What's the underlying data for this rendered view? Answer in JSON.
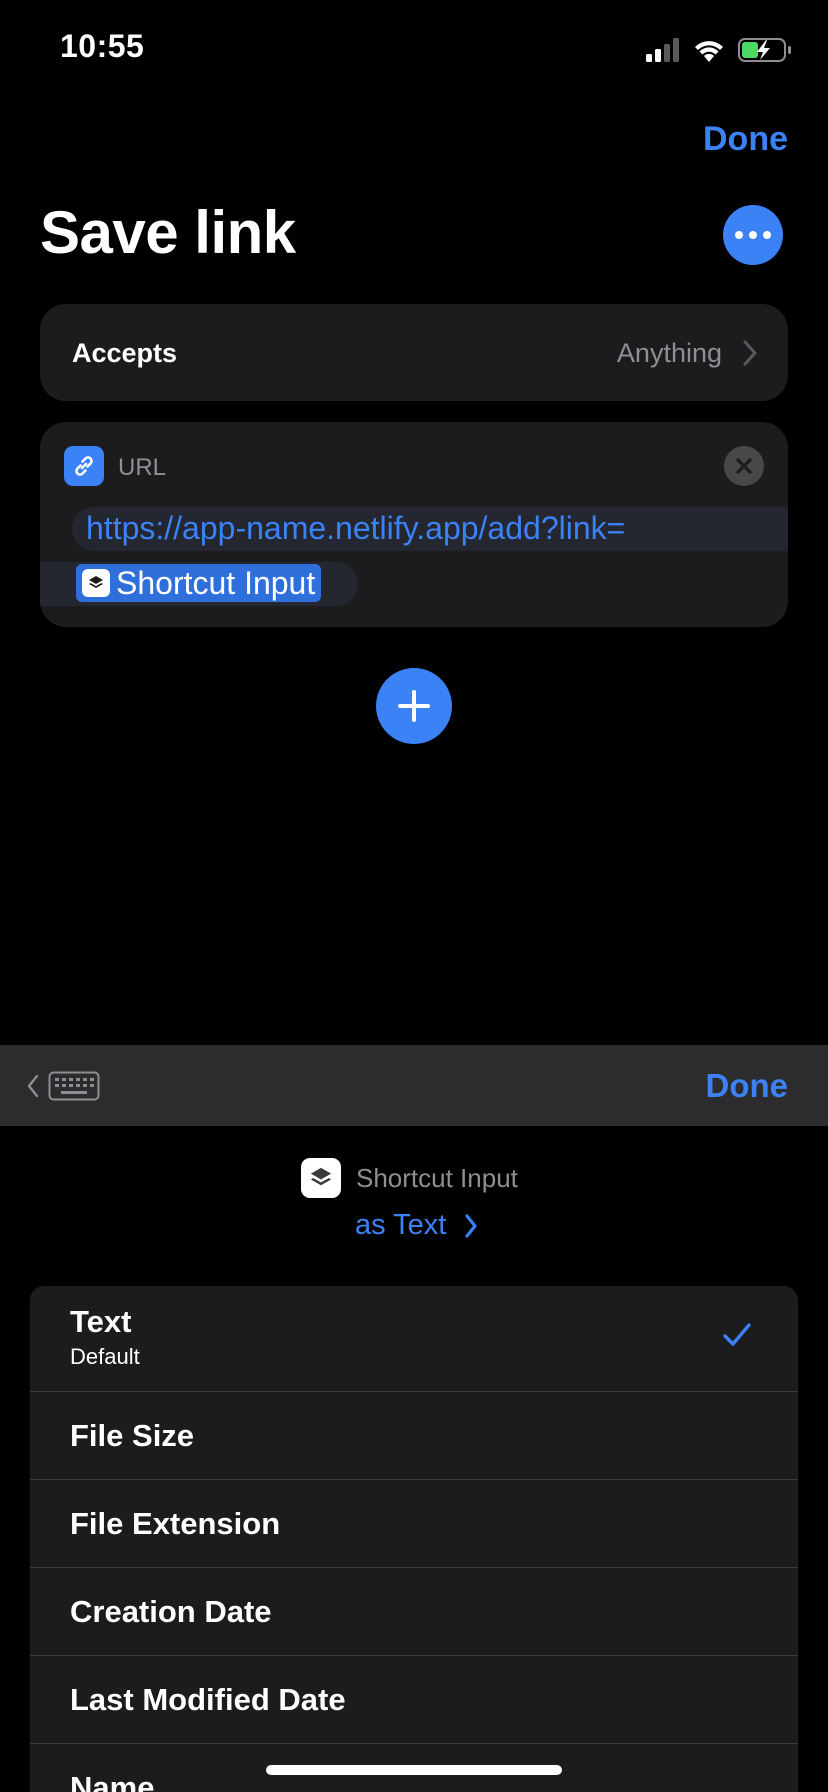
{
  "status_bar": {
    "time": "10:55"
  },
  "header": {
    "done_label": "Done",
    "title": "Save link"
  },
  "accepts": {
    "label": "Accepts",
    "value": "Anything"
  },
  "url_action": {
    "label": "URL",
    "url_text": "https://app-name.netlify.app/add?link=",
    "variable_token": "Shortcut Input"
  },
  "toolbar": {
    "done_label": "Done"
  },
  "variable_picker": {
    "variable_name": "Shortcut Input",
    "as_label": "as Text",
    "options": [
      {
        "label": "Text",
        "sublabel": "Default",
        "selected": true
      },
      {
        "label": "File Size"
      },
      {
        "label": "File Extension"
      },
      {
        "label": "Creation Date"
      },
      {
        "label": "Last Modified Date"
      },
      {
        "label": "Name"
      }
    ]
  },
  "colors": {
    "accent": "#3b82f6",
    "card": "#1c1c1e",
    "toolbar": "#2c2c2e",
    "battery": "#4cd964"
  }
}
